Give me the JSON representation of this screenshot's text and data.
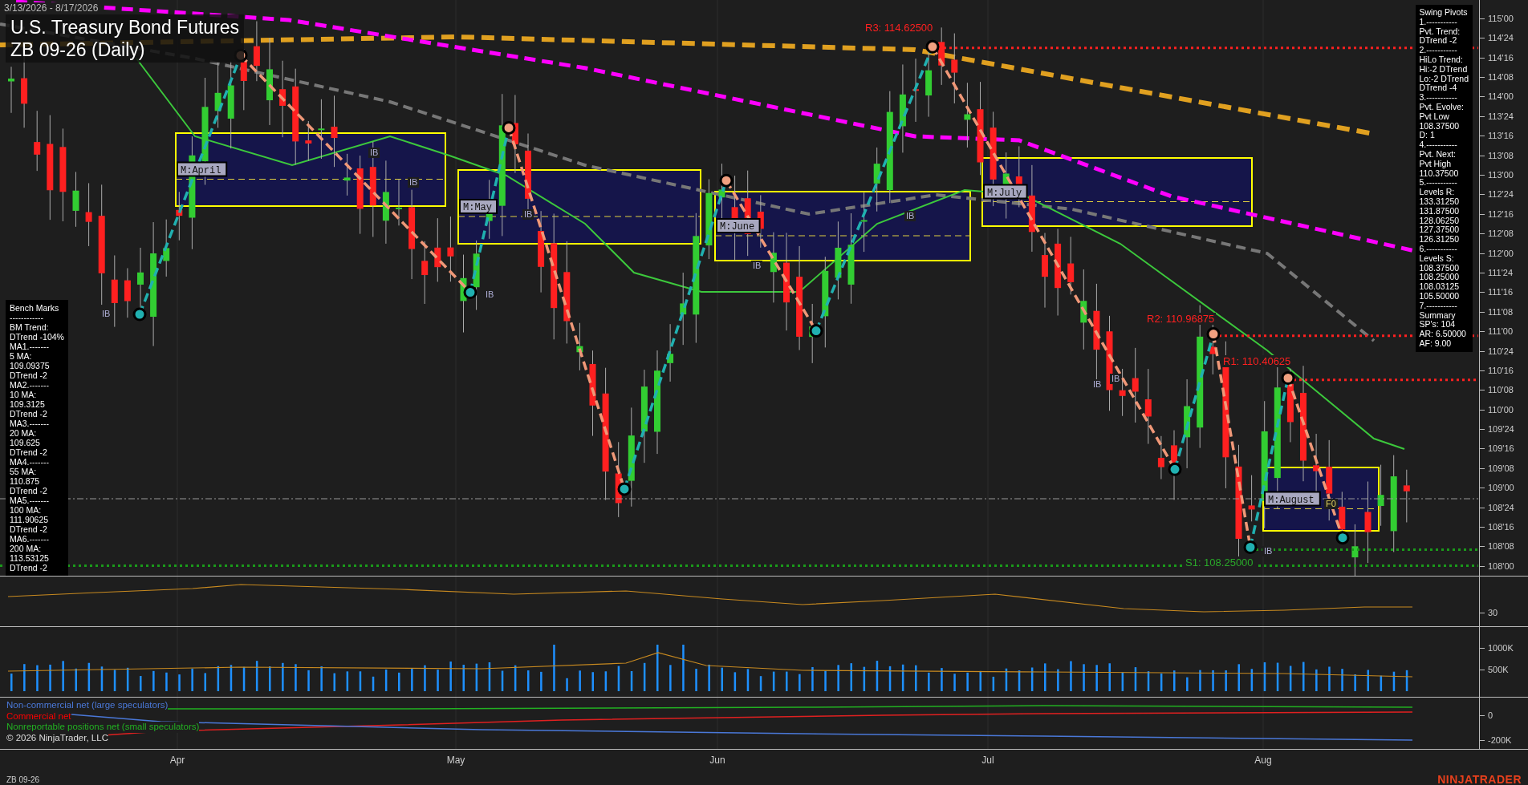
{
  "header": {
    "date_range": "3/13/2026 - 8/17/2026",
    "title": "U.S. Treasury Bond Futures",
    "subtitle": "ZB 09-26 (Daily)"
  },
  "bench_marks": [
    "Bench Marks",
    "------------",
    "BM Trend:",
    "DTrend -104%",
    "MA1.-------",
    "5 MA:",
    "109.09375",
    "DTrend -2",
    "MA2.-------",
    "10 MA:",
    "109.3125",
    "DTrend -2",
    "MA3.-------",
    "20 MA:",
    "109.625",
    "DTrend -2",
    "MA4.-------",
    "55 MA:",
    "110.875",
    "DTrend -2",
    "MA5.-------",
    "100 MA:",
    "111.90625",
    "DTrend -2",
    "MA6.-------",
    "200 MA:",
    "113.53125",
    "DTrend -2"
  ],
  "swing_pivots": [
    "Swing Pivots",
    "1.-----------",
    "Pvt. Trend:",
    "DTrend -2",
    "2.-----------",
    "HiLo Trend:",
    "Hi:-2 DTrend",
    "Lo:-2 DTrend",
    "DTrend -4",
    "3.-----------",
    "Pvt. Evolve:",
    "Pvt Low",
    "108.37500",
    "D: 1",
    "4.-----------",
    "Pvt. Next:",
    "Pvt High",
    "110.37500",
    "5.-----------",
    "Levels R:",
    "133.31250",
    "131.87500",
    "128.06250",
    "127.37500",
    "126.31250",
    "6.-----------",
    "Levels S:",
    "108.37500",
    "108.25000",
    "108.03125",
    "105.50000",
    "7.-----------",
    "Summary",
    "SP's: 104",
    "AR: 6.50000",
    "AF: 9.00"
  ],
  "pivot_labels": [
    {
      "text": "R3: 114.62500",
      "kind": "resistance"
    },
    {
      "text": "R2: 110.96875",
      "kind": "resistance"
    },
    {
      "text": "R1: 110.40625",
      "kind": "resistance"
    },
    {
      "text": "S1: 108.25000",
      "kind": "support"
    }
  ],
  "month_boxes": [
    "M:April",
    "M:May",
    "M:June",
    "M:July",
    "M:August"
  ],
  "bar_markers": [
    "IB",
    "IB",
    "IB",
    "IB",
    "IB",
    "IB",
    "IB",
    "IB",
    "IB",
    "IB",
    "F0"
  ],
  "price_axis": [
    "115'00",
    "114'24",
    "114'16",
    "114'08",
    "114'00",
    "113'24",
    "113'16",
    "113'08",
    "113'00",
    "112'24",
    "112'16",
    "112'08",
    "112'00",
    "111'24",
    "111'16",
    "111'08",
    "111'00",
    "110'24",
    "110'16",
    "110'08",
    "110'00",
    "109'24",
    "109'16",
    "109'08",
    "109'00",
    "108'24",
    "108'16",
    "108'08",
    "108'00"
  ],
  "oscillator_axis": [
    "30"
  ],
  "volume_axis": [
    "1000K",
    "500K"
  ],
  "cot_axis": [
    "0",
    "-200K"
  ],
  "cot_legend": [
    {
      "text": "Non-commercial net (large speculators)",
      "color": "#4a78d8"
    },
    {
      "text": "Commercial net",
      "color": "#ff0000"
    },
    {
      "text": "Nonreportable positions net (small speculators)",
      "color": "#22b022"
    }
  ],
  "copyright": "© 2026 NinjaTrader, LLC",
  "x_axis": [
    "Apr",
    "May",
    "Jun",
    "Jul",
    "Aug"
  ],
  "footer": {
    "instrument": "ZB 09-26",
    "logo": "NINJATRADER"
  }
}
